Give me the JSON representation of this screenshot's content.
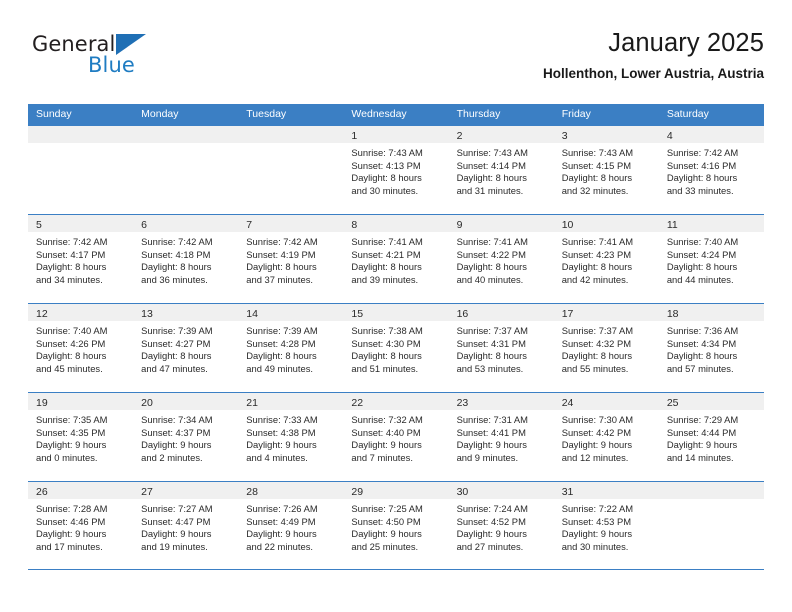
{
  "brand": {
    "name_top": "General",
    "name_bottom": "Blue",
    "accent_color": "#1f7cc2",
    "triangle_color": "#1f6fb5"
  },
  "header": {
    "title": "January 2025",
    "subtitle": "Hollenthon, Lower Austria, Austria"
  },
  "calendar": {
    "header_bg": "#3b7fc4",
    "day_strip_bg": "#f0f0f0",
    "weekdays": [
      "Sunday",
      "Monday",
      "Tuesday",
      "Wednesday",
      "Thursday",
      "Friday",
      "Saturday"
    ],
    "weeks": [
      [
        {
          "day": "",
          "sunrise": "",
          "sunset": "",
          "daylight1": "",
          "daylight2": ""
        },
        {
          "day": "",
          "sunrise": "",
          "sunset": "",
          "daylight1": "",
          "daylight2": ""
        },
        {
          "day": "",
          "sunrise": "",
          "sunset": "",
          "daylight1": "",
          "daylight2": ""
        },
        {
          "day": "1",
          "sunrise": "Sunrise: 7:43 AM",
          "sunset": "Sunset: 4:13 PM",
          "daylight1": "Daylight: 8 hours",
          "daylight2": "and 30 minutes."
        },
        {
          "day": "2",
          "sunrise": "Sunrise: 7:43 AM",
          "sunset": "Sunset: 4:14 PM",
          "daylight1": "Daylight: 8 hours",
          "daylight2": "and 31 minutes."
        },
        {
          "day": "3",
          "sunrise": "Sunrise: 7:43 AM",
          "sunset": "Sunset: 4:15 PM",
          "daylight1": "Daylight: 8 hours",
          "daylight2": "and 32 minutes."
        },
        {
          "day": "4",
          "sunrise": "Sunrise: 7:42 AM",
          "sunset": "Sunset: 4:16 PM",
          "daylight1": "Daylight: 8 hours",
          "daylight2": "and 33 minutes."
        }
      ],
      [
        {
          "day": "5",
          "sunrise": "Sunrise: 7:42 AM",
          "sunset": "Sunset: 4:17 PM",
          "daylight1": "Daylight: 8 hours",
          "daylight2": "and 34 minutes."
        },
        {
          "day": "6",
          "sunrise": "Sunrise: 7:42 AM",
          "sunset": "Sunset: 4:18 PM",
          "daylight1": "Daylight: 8 hours",
          "daylight2": "and 36 minutes."
        },
        {
          "day": "7",
          "sunrise": "Sunrise: 7:42 AM",
          "sunset": "Sunset: 4:19 PM",
          "daylight1": "Daylight: 8 hours",
          "daylight2": "and 37 minutes."
        },
        {
          "day": "8",
          "sunrise": "Sunrise: 7:41 AM",
          "sunset": "Sunset: 4:21 PM",
          "daylight1": "Daylight: 8 hours",
          "daylight2": "and 39 minutes."
        },
        {
          "day": "9",
          "sunrise": "Sunrise: 7:41 AM",
          "sunset": "Sunset: 4:22 PM",
          "daylight1": "Daylight: 8 hours",
          "daylight2": "and 40 minutes."
        },
        {
          "day": "10",
          "sunrise": "Sunrise: 7:41 AM",
          "sunset": "Sunset: 4:23 PM",
          "daylight1": "Daylight: 8 hours",
          "daylight2": "and 42 minutes."
        },
        {
          "day": "11",
          "sunrise": "Sunrise: 7:40 AM",
          "sunset": "Sunset: 4:24 PM",
          "daylight1": "Daylight: 8 hours",
          "daylight2": "and 44 minutes."
        }
      ],
      [
        {
          "day": "12",
          "sunrise": "Sunrise: 7:40 AM",
          "sunset": "Sunset: 4:26 PM",
          "daylight1": "Daylight: 8 hours",
          "daylight2": "and 45 minutes."
        },
        {
          "day": "13",
          "sunrise": "Sunrise: 7:39 AM",
          "sunset": "Sunset: 4:27 PM",
          "daylight1": "Daylight: 8 hours",
          "daylight2": "and 47 minutes."
        },
        {
          "day": "14",
          "sunrise": "Sunrise: 7:39 AM",
          "sunset": "Sunset: 4:28 PM",
          "daylight1": "Daylight: 8 hours",
          "daylight2": "and 49 minutes."
        },
        {
          "day": "15",
          "sunrise": "Sunrise: 7:38 AM",
          "sunset": "Sunset: 4:30 PM",
          "daylight1": "Daylight: 8 hours",
          "daylight2": "and 51 minutes."
        },
        {
          "day": "16",
          "sunrise": "Sunrise: 7:37 AM",
          "sunset": "Sunset: 4:31 PM",
          "daylight1": "Daylight: 8 hours",
          "daylight2": "and 53 minutes."
        },
        {
          "day": "17",
          "sunrise": "Sunrise: 7:37 AM",
          "sunset": "Sunset: 4:32 PM",
          "daylight1": "Daylight: 8 hours",
          "daylight2": "and 55 minutes."
        },
        {
          "day": "18",
          "sunrise": "Sunrise: 7:36 AM",
          "sunset": "Sunset: 4:34 PM",
          "daylight1": "Daylight: 8 hours",
          "daylight2": "and 57 minutes."
        }
      ],
      [
        {
          "day": "19",
          "sunrise": "Sunrise: 7:35 AM",
          "sunset": "Sunset: 4:35 PM",
          "daylight1": "Daylight: 9 hours",
          "daylight2": "and 0 minutes."
        },
        {
          "day": "20",
          "sunrise": "Sunrise: 7:34 AM",
          "sunset": "Sunset: 4:37 PM",
          "daylight1": "Daylight: 9 hours",
          "daylight2": "and 2 minutes."
        },
        {
          "day": "21",
          "sunrise": "Sunrise: 7:33 AM",
          "sunset": "Sunset: 4:38 PM",
          "daylight1": "Daylight: 9 hours",
          "daylight2": "and 4 minutes."
        },
        {
          "day": "22",
          "sunrise": "Sunrise: 7:32 AM",
          "sunset": "Sunset: 4:40 PM",
          "daylight1": "Daylight: 9 hours",
          "daylight2": "and 7 minutes."
        },
        {
          "day": "23",
          "sunrise": "Sunrise: 7:31 AM",
          "sunset": "Sunset: 4:41 PM",
          "daylight1": "Daylight: 9 hours",
          "daylight2": "and 9 minutes."
        },
        {
          "day": "24",
          "sunrise": "Sunrise: 7:30 AM",
          "sunset": "Sunset: 4:42 PM",
          "daylight1": "Daylight: 9 hours",
          "daylight2": "and 12 minutes."
        },
        {
          "day": "25",
          "sunrise": "Sunrise: 7:29 AM",
          "sunset": "Sunset: 4:44 PM",
          "daylight1": "Daylight: 9 hours",
          "daylight2": "and 14 minutes."
        }
      ],
      [
        {
          "day": "26",
          "sunrise": "Sunrise: 7:28 AM",
          "sunset": "Sunset: 4:46 PM",
          "daylight1": "Daylight: 9 hours",
          "daylight2": "and 17 minutes."
        },
        {
          "day": "27",
          "sunrise": "Sunrise: 7:27 AM",
          "sunset": "Sunset: 4:47 PM",
          "daylight1": "Daylight: 9 hours",
          "daylight2": "and 19 minutes."
        },
        {
          "day": "28",
          "sunrise": "Sunrise: 7:26 AM",
          "sunset": "Sunset: 4:49 PM",
          "daylight1": "Daylight: 9 hours",
          "daylight2": "and 22 minutes."
        },
        {
          "day": "29",
          "sunrise": "Sunrise: 7:25 AM",
          "sunset": "Sunset: 4:50 PM",
          "daylight1": "Daylight: 9 hours",
          "daylight2": "and 25 minutes."
        },
        {
          "day": "30",
          "sunrise": "Sunrise: 7:24 AM",
          "sunset": "Sunset: 4:52 PM",
          "daylight1": "Daylight: 9 hours",
          "daylight2": "and 27 minutes."
        },
        {
          "day": "31",
          "sunrise": "Sunrise: 7:22 AM",
          "sunset": "Sunset: 4:53 PM",
          "daylight1": "Daylight: 9 hours",
          "daylight2": "and 30 minutes."
        },
        {
          "day": "",
          "sunrise": "",
          "sunset": "",
          "daylight1": "",
          "daylight2": ""
        }
      ]
    ]
  }
}
